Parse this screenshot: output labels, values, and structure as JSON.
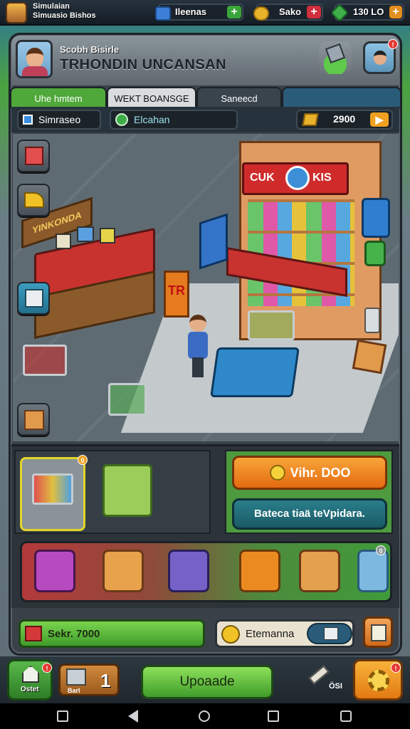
{
  "app": {
    "title_line1": "Simulaian",
    "title_line2": "Simuasio Bishos"
  },
  "currencies": [
    {
      "icon": "cash-icon",
      "value": "Ileenas",
      "color": "#3d7fd6"
    },
    {
      "icon": "gold-coin-icon",
      "value": "Sako",
      "color": "#e8b22a"
    },
    {
      "icon": "gem-icon",
      "value": "130 LO",
      "color": "#3fae48"
    }
  ],
  "header": {
    "subtitle": "Scobh Bisirle",
    "store_name": "TRHONDIN UNCANSAN",
    "notification_count": "!"
  },
  "tabs": [
    {
      "label": "Uhe hmtem",
      "active": true
    },
    {
      "label": "WEKT BOANSGE",
      "active": false
    },
    {
      "label": "Saneecd",
      "active": false
    }
  ],
  "fields": {
    "store_label": "Simraseo",
    "category_label": "Elcahan",
    "coins": "2900"
  },
  "scene": {
    "stall_sign": "YINKONDA",
    "store_sign_left": "CUK",
    "store_sign_right": "KIS",
    "promo_sign": "TR"
  },
  "upgrade_panel": {
    "cart_badge": "0",
    "buy_label": "Vihr. DOO",
    "upgrade_info": "Bateca tiaä teVpidara.",
    "strip_badge": "0"
  },
  "status": {
    "sales_label": "Sekr. 7000",
    "info_label": "Etemanna"
  },
  "bottom_nav": {
    "home_label": "Ostet",
    "bank_label": "Barl",
    "bank_count": "1",
    "upgrade_label": "Upoaade",
    "tool_label": "ÖSI",
    "home_badge": "!",
    "settings_badge": "!"
  }
}
